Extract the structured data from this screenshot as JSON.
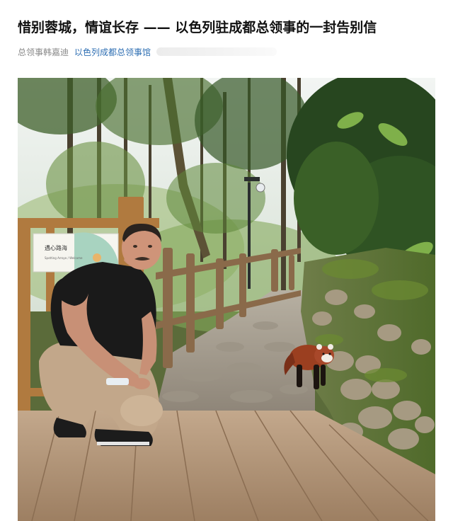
{
  "article": {
    "title": "惜别蓉城，情谊长存 —— 以色列驻成都总领事的一封告别信",
    "author": "总领事韩嘉迪",
    "account": "以色列成都总领事馆"
  },
  "photo": {
    "sign_text": "遇心路海",
    "sign_small": "Spotting Arroyo  /  Welcome",
    "colors": {
      "sky": "#eaf0ee",
      "foliage_dark": "#27461f",
      "foliage_mid": "#3f6a2a",
      "foliage_light": "#7fa54a",
      "deck": "#b89a7c",
      "shirt": "#1a1a1a",
      "pants": "#c2a78a",
      "panda_fur": "#9b3f20"
    }
  }
}
